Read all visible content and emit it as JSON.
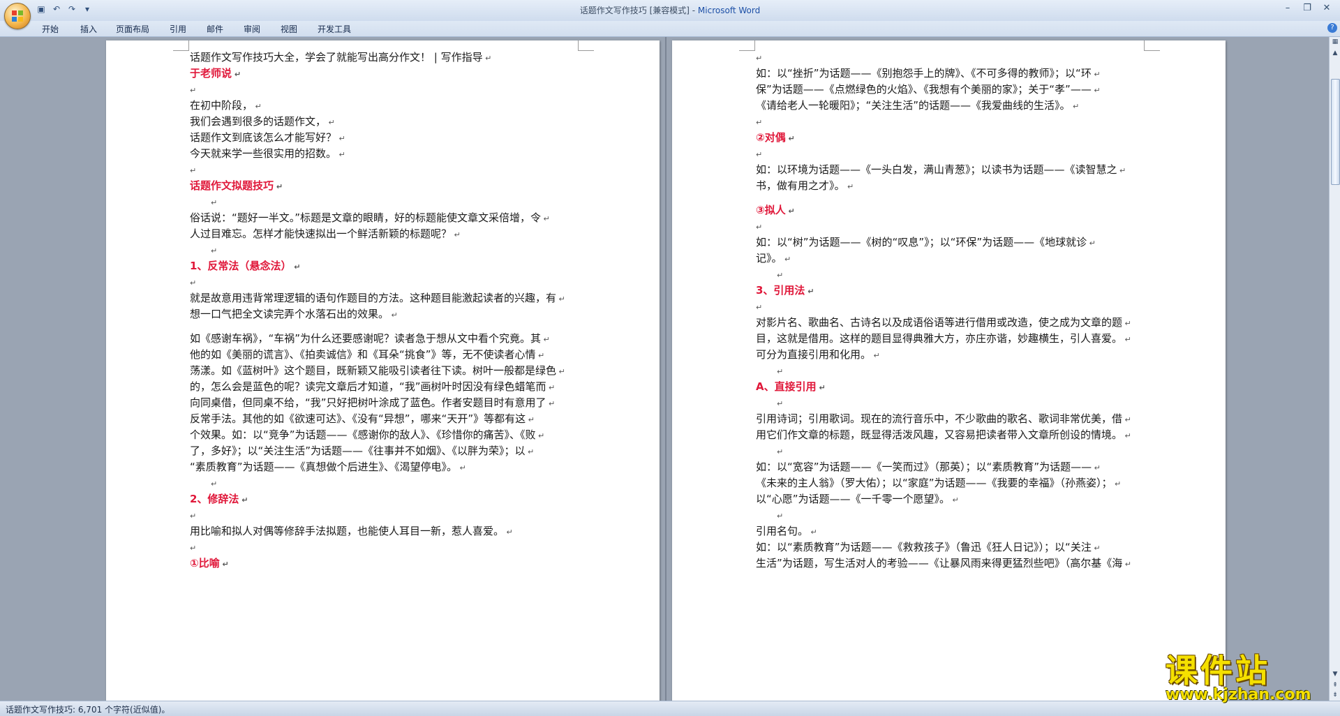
{
  "window": {
    "title_doc": "话题作文写作技巧 [兼容模式] - ",
    "title_app": "Microsoft Word"
  },
  "ribbon_tabs": [
    "开始",
    "插入",
    "页面布局",
    "引用",
    "邮件",
    "审阅",
    "视图",
    "开发工具"
  ],
  "status": {
    "text": "话题作文写作技巧: 6,701 个字符(近似值)。"
  },
  "watermark": {
    "title": "课件站",
    "url": "www.kjzhan.com"
  },
  "left_page": [
    {
      "t": "话题作文写作技巧大全，学会了就能写出高分作文！ | 写作指导",
      "s": "p"
    },
    {
      "t": "于老师说",
      "s": "h"
    },
    {
      "t": "",
      "s": "blank"
    },
    {
      "t": "在初中阶段，",
      "s": "p"
    },
    {
      "t": "我们会遇到很多的话题作文，",
      "s": "p"
    },
    {
      "t": "话题作文到底该怎么才能写好？",
      "s": "p"
    },
    {
      "t": "今天就来学一些很实用的招数。",
      "s": "p"
    },
    {
      "t": "",
      "s": "blank"
    },
    {
      "t": "话题作文拟题技巧",
      "s": "h"
    },
    {
      "t": "",
      "s": "blank-i"
    },
    {
      "t": "俗话说：“题好一半文。”标题是文章的眼睛，好的标题能使文章文采倍增，令",
      "s": "p"
    },
    {
      "t": "人过目难忘。怎样才能快速拟出一个鲜活新颖的标题呢？",
      "s": "p"
    },
    {
      "t": "",
      "s": "blank-i"
    },
    {
      "t": "1、反常法（悬念法）",
      "s": "h"
    },
    {
      "t": "",
      "s": "blank"
    },
    {
      "t": "就是故意用违背常理逻辑的语句作题目的方法。这种题目能激起读者的兴趣，有",
      "s": "p"
    },
    {
      "t": "想一口气把全文读完弄个水落石出的效果。",
      "s": "p"
    },
    {
      "t": "",
      "s": "gap"
    },
    {
      "t": "如《感谢车祸》，“车祸”为什么还要感谢呢？读者急于想从文中看个究竟。其",
      "s": "p"
    },
    {
      "t": "他的如《美丽的谎言》、《拍卖诚信》和《耳朵“挑食”》等，无不使读者心情",
      "s": "p"
    },
    {
      "t": "荡漾。如《蓝树叶》这个题目，既新颖又能吸引读者往下读。树叶一般都是绿色",
      "s": "p"
    },
    {
      "t": "的，怎么会是蓝色的呢？读完文章后才知道，“我”画树叶时因没有绿色蜡笔而",
      "s": "p"
    },
    {
      "t": "向同桌借，但同桌不给，“我”只好把树叶涂成了蓝色。作者安题目时有意用了",
      "s": "p"
    },
    {
      "t": "反常手法。其他的如《欲速可达》、《没有“异想”，哪来“天开”》等都有这",
      "s": "p"
    },
    {
      "t": "个效果。如：以“竞争”为话题——《感谢你的敌人》、《珍惜你的痛苦》、《败",
      "s": "p"
    },
    {
      "t": "了，多好》；以“关注生活”为话题——《往事并不如烟》、《以胖为荣》；以",
      "s": "p"
    },
    {
      "t": "“素质教育”为话题——《真想做个后进生》、《渴望停电》。",
      "s": "p"
    },
    {
      "t": "",
      "s": "blank-i"
    },
    {
      "t": "2、修辞法",
      "s": "h"
    },
    {
      "t": "",
      "s": "blank"
    },
    {
      "t": "用比喻和拟人对偶等修辞手法拟题，也能使人耳目一新，惹人喜爱。",
      "s": "p"
    },
    {
      "t": "",
      "s": "blank"
    },
    {
      "t": "①比喻",
      "s": "h"
    }
  ],
  "right_page": [
    {
      "t": "",
      "s": "blank"
    },
    {
      "t": "如：以“挫折”为话题——《别抱怨手上的牌》、《不可多得的教师》；以“环",
      "s": "p"
    },
    {
      "t": "保”为话题——《点燃绿色的火焰》、《我想有个美丽的家》；关于“孝”——",
      "s": "p"
    },
    {
      "t": "《请给老人一轮暖阳》；“关注生活”的话题——《我爱曲线的生活》。",
      "s": "p"
    },
    {
      "t": "",
      "s": "blank"
    },
    {
      "t": "②对偶",
      "s": "h"
    },
    {
      "t": "",
      "s": "blank"
    },
    {
      "t": "如：以环境为话题——《一头白发，满山青葱》；以读书为话题——《读智慧之",
      "s": "p"
    },
    {
      "t": "书，做有用之才》。",
      "s": "p"
    },
    {
      "t": "",
      "s": "gap"
    },
    {
      "t": "③拟人",
      "s": "h"
    },
    {
      "t": "",
      "s": "blank"
    },
    {
      "t": "如：以“树”为话题——《树的“叹息”》；以“环保”为话题——《地球就诊",
      "s": "p"
    },
    {
      "t": "记》。",
      "s": "p"
    },
    {
      "t": "",
      "s": "blank-i"
    },
    {
      "t": "3、引用法",
      "s": "h"
    },
    {
      "t": "",
      "s": "blank"
    },
    {
      "t": "对影片名、歌曲名、古诗名以及成语俗语等进行借用或改造，使之成为文章的题",
      "s": "p"
    },
    {
      "t": "目，这就是借用。这样的题目显得典雅大方，亦庄亦谐，妙趣横生，引人喜爱。",
      "s": "p"
    },
    {
      "t": "可分为直接引用和化用。",
      "s": "p"
    },
    {
      "t": "",
      "s": "blank-i"
    },
    {
      "t": "A、直接引用",
      "s": "h"
    },
    {
      "t": "",
      "s": "blank-i"
    },
    {
      "t": "引用诗词；引用歌词。现在的流行音乐中，不少歌曲的歌名、歌词非常优美，借",
      "s": "p"
    },
    {
      "t": "用它们作文章的标题，既显得活泼风趣，又容易把读者带入文章所创设的情境。",
      "s": "p"
    },
    {
      "t": "",
      "s": "blank-i"
    },
    {
      "t": "如：以“宽容”为话题——《一笑而过》（那英）；以“素质教育”为话题——",
      "s": "p"
    },
    {
      "t": "《未来的主人翁》（罗大佑）；以“家庭”为话题——《我要的幸福》（孙燕姿）；",
      "s": "p"
    },
    {
      "t": "以“心愿”为话题——《一千零一个愿望》。",
      "s": "p"
    },
    {
      "t": "",
      "s": "blank-i"
    },
    {
      "t": "引用名句。",
      "s": "p"
    },
    {
      "t": "如：以“素质教育”为话题——《救救孩子》（鲁迅《狂人日记》）；以“关注",
      "s": "p"
    },
    {
      "t": "生活”为话题，写生活对人的考验——《让暴风雨来得更猛烈些吧》（高尔基《海",
      "s": "p"
    }
  ]
}
